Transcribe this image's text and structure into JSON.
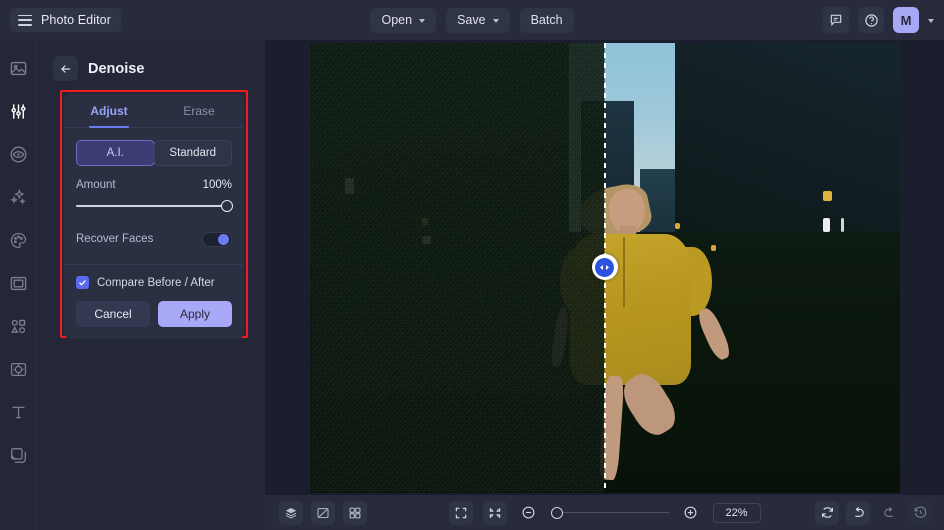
{
  "app": {
    "name": "Photo Editor",
    "menu_icon": "hamburger-icon"
  },
  "topbar": {
    "open_label": "Open",
    "save_label": "Save",
    "batch_label": "Batch",
    "feedback_icon": "chat-icon",
    "help_icon": "question-circle-icon",
    "avatar_initial": "M",
    "account_caret": "chevron-down-icon",
    "accent_avatar": "#a9a8f7"
  },
  "sidebar": {
    "items": [
      {
        "name": "image",
        "icon": "image-icon",
        "active": false
      },
      {
        "name": "adjust",
        "icon": "sliders-icon",
        "active": true
      },
      {
        "name": "retouch-eye",
        "icon": "eye-icon",
        "active": false
      },
      {
        "name": "effects",
        "icon": "sparkles-icon",
        "active": false
      },
      {
        "name": "color",
        "icon": "palette-icon",
        "active": false
      },
      {
        "name": "crop-frame",
        "icon": "frame-icon",
        "active": false
      },
      {
        "name": "shapes",
        "icon": "shapes-icon",
        "active": false
      },
      {
        "name": "ai-tools",
        "icon": "focus-square-icon",
        "active": false
      },
      {
        "name": "text",
        "icon": "text-t-icon",
        "active": false
      },
      {
        "name": "layers",
        "icon": "layers-copy-icon",
        "active": false
      }
    ]
  },
  "panel": {
    "back_icon": "arrow-left-icon",
    "title": "Denoise",
    "tabs": [
      {
        "label": "Adjust",
        "active": true
      },
      {
        "label": "Erase",
        "active": false
      }
    ],
    "mode": {
      "options": [
        {
          "label": "A.I.",
          "selected": true
        },
        {
          "label": "Standard",
          "selected": false
        }
      ]
    },
    "amount": {
      "label": "Amount",
      "value": "100%",
      "percent": 100
    },
    "recover_faces": {
      "label": "Recover Faces",
      "enabled": true
    },
    "compare": {
      "label": "Compare Before / After",
      "checked": true,
      "check_icon": "checkmark-icon"
    },
    "cancel_label": "Cancel",
    "apply_label": "Apply",
    "accent_tab": "#6f7bf0",
    "accent_apply": "#a9a8f7",
    "highlight_box_color": "#ef1d1d"
  },
  "canvas": {
    "compare_handle_icon": "left-right-arrows-icon",
    "split_percent": 50,
    "before_label": "noisy original (left of split)",
    "after_label": "denoised result (right of split)"
  },
  "bottombar": {
    "left_tools": [
      {
        "name": "layers",
        "icon": "stack-icon"
      },
      {
        "name": "compare-split",
        "icon": "split-compare-icon"
      },
      {
        "name": "grid-view",
        "icon": "grid-icon"
      }
    ],
    "view_tools": [
      {
        "name": "fit-to-screen",
        "icon": "expand-brackets-icon"
      },
      {
        "name": "actual-size",
        "icon": "collapse-arrows-icon"
      }
    ],
    "zoom_out_icon": "minus-circle-icon",
    "zoom_in_icon": "plus-circle-icon",
    "zoom_level": "22%",
    "zoom_percent": 4,
    "right_tools": [
      {
        "name": "rotate",
        "icon": "rotate-refresh-icon",
        "dim": false
      },
      {
        "name": "undo",
        "icon": "undo-arrow-icon",
        "dim": false
      },
      {
        "name": "redo",
        "icon": "redo-arrow-icon",
        "dim": true
      },
      {
        "name": "history",
        "icon": "clock-history-icon",
        "dim": true
      }
    ]
  }
}
